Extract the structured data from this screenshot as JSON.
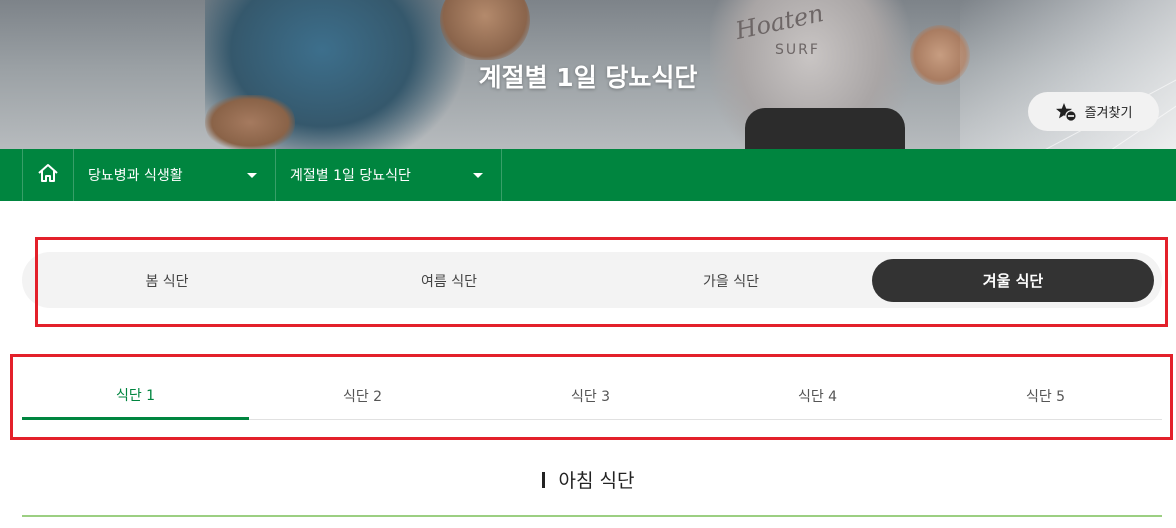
{
  "hero": {
    "title": "계절별 1일 당뇨식단",
    "shirt_text": "Hoaten",
    "shirt_subtext": "SURF"
  },
  "favorite": {
    "label": "즐겨찾기",
    "icon": "star-minus-icon"
  },
  "breadcrumb": {
    "home_icon": "home-icon",
    "items": [
      {
        "label": "당뇨병과 식생활"
      },
      {
        "label": "계절별 1일 당뇨식단"
      }
    ]
  },
  "season_tabs": {
    "items": [
      {
        "label": "봄 식단"
      },
      {
        "label": "여름 식단"
      },
      {
        "label": "가을 식단"
      },
      {
        "label": "겨울 식단"
      }
    ],
    "active": "겨울 식단"
  },
  "meal_tabs": {
    "items": [
      {
        "label": "식단 1"
      },
      {
        "label": "식단 2"
      },
      {
        "label": "식단 3"
      },
      {
        "label": "식단 4"
      },
      {
        "label": "식단 5"
      }
    ],
    "active": "식단 1"
  },
  "section": {
    "title": "아침 식단"
  },
  "colors": {
    "brand_green": "#00853f",
    "active_dark": "#333333",
    "annotation_red": "#e3202a",
    "rule_green": "#9ccf82"
  }
}
